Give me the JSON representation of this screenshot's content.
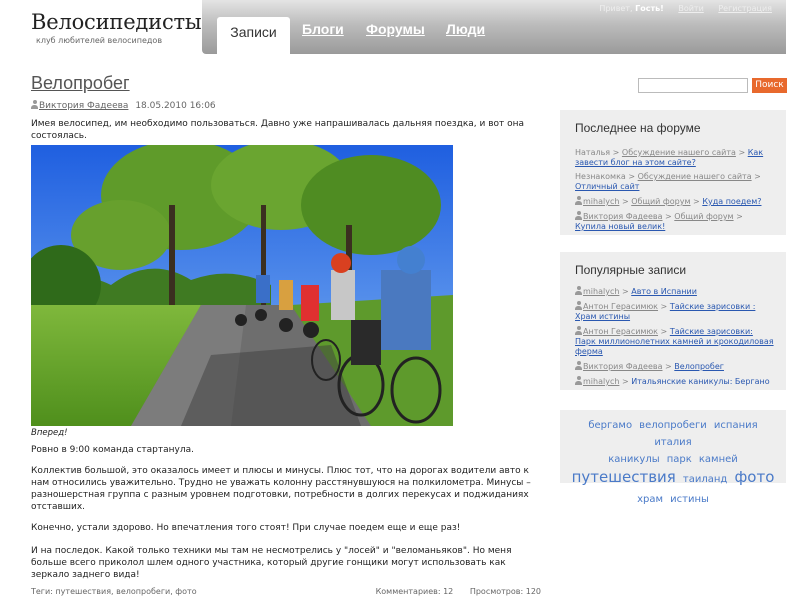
{
  "site": {
    "name": "Велосипедисты",
    "tagline": "клуб любителей велосипедов"
  },
  "nav": {
    "active_tab": "Записи",
    "tabs": [
      "Блоги",
      "Форумы",
      "Люди"
    ]
  },
  "userbar": {
    "greeting": "Привет,",
    "guest": "Гость!",
    "login": "Войти",
    "register": "Регистрация"
  },
  "search": {
    "placeholder": "",
    "button": "Поиск"
  },
  "post": {
    "title": "Велопробег",
    "author": "Виктория Фадеева",
    "date": "18.05.2010 16:06",
    "intro": "Имея велосипед, им необходимо пользоваться. Давно уже напрашивалась дальняя поездка, и вот она состоялась.",
    "image_caption": "Вперед!",
    "paragraphs": [
      "Ровно в 9:00 команда стартанула.",
      "Коллектив большой, это оказалось имеет и плюсы и минусы. Плюс тот, что на дорогах водители авто к нам относились уважительно. Трудно не уважать колонну расстянувшуюся на полкилометра. Минусы – разношерстная группа с разным уровнем подготовки, потребности в долгих перекусах и поджиданиях отставших.",
      "Конечно, устали здорово. Но впечатления того стоят! При случае поедем еще и еще раз!",
      "И на последок. Какой только техники мы там не несмотрелись у \"лосей\" и \"веломаньяков\". Но меня больше всего приколол шлем одного участника, который другие гонщики могут использовать как зеркало заднего вида!"
    ],
    "tags_line": "Теги: путешествия, велопробеги, фото",
    "comments": "Комментариев: 12",
    "views": "Просмотров: 120"
  },
  "forum_widget": {
    "title": "Последнее на форуме",
    "items": [
      {
        "user": "Наталья",
        "group": "Обсуждение нашего сайта",
        "topic": "Как завести блог на этом сайте?",
        "icon": false
      },
      {
        "user": "Незнакомка",
        "group": "Обсуждение нашего сайта",
        "topic": "Отличный сайт",
        "icon": false
      },
      {
        "user": "mihalych",
        "group": "Общий форум",
        "topic": "Куда поедем?",
        "icon": true
      },
      {
        "user": "Виктория Фадеева",
        "group": "Общий форум",
        "topic": "Купила новый велик!",
        "icon": true
      }
    ]
  },
  "popular_widget": {
    "title": "Популярные записи",
    "items": [
      {
        "user": "mihalych",
        "topic": "Авто в Испании",
        "linked": true
      },
      {
        "user": "Антон Герасимюк",
        "topic": "Тайские зарисовки : Храм истины",
        "linked": true
      },
      {
        "user": "Антон Герасимюк",
        "topic": "Тайские зарисовки: Парк миллионолетних камней и крокодиловая ферма",
        "linked": true
      },
      {
        "user": "Виктория Фадеева",
        "topic": "Велопробег",
        "linked": true
      },
      {
        "user": "mihalych",
        "topic": "Итальянские каникулы: Бергано",
        "linked": false
      }
    ]
  },
  "tag_cloud": {
    "line1": [
      "бергамо",
      "велопробеги",
      "испания",
      "италия"
    ],
    "line2": [
      "каникулы",
      "парк",
      "камней"
    ],
    "line3_big": "путешествия",
    "line3_small": "таиланд",
    "line3_big2": "фото",
    "line4": [
      "храм",
      "истины"
    ]
  },
  "colors": {
    "accent": "#e8692d",
    "link": "#2a58b0",
    "tag": "#4a7ac8",
    "sidebar_bg": "#eeeeee"
  },
  "icons": {
    "author": "user-icon"
  }
}
